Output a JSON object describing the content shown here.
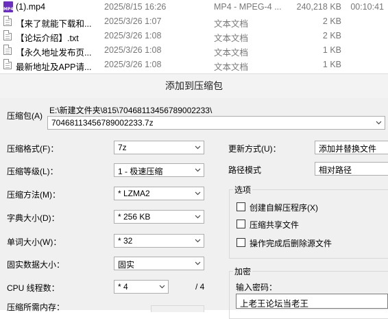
{
  "files": [
    {
      "name": "(1).mp4",
      "date": "2025/8/15 16:26",
      "type": "MP4 - MPEG-4 ...",
      "size": "240,218 KB",
      "duration": "00:10:41",
      "icon": "mp4-file-icon"
    },
    {
      "name": "【来了就能下载和...",
      "date": "2025/3/26 1:07",
      "type": "文本文档",
      "size": "2 KB",
      "duration": "",
      "icon": "text-file-icon"
    },
    {
      "name": "【论坛介绍】.txt",
      "date": "2025/3/26 1:08",
      "type": "文本文档",
      "size": "2 KB",
      "duration": "",
      "icon": "text-file-icon"
    },
    {
      "name": "【永久地址发布页...",
      "date": "2025/3/26 1:08",
      "type": "文本文档",
      "size": "1 KB",
      "duration": "",
      "icon": "text-file-icon"
    },
    {
      "name": "最新地址及APP请...",
      "date": "2025/3/26 1:08",
      "type": "文本文档",
      "size": "1 KB",
      "duration": "",
      "icon": "text-file-icon"
    }
  ],
  "dialog": {
    "title": "添加到压缩包",
    "archive_label": "压缩包(A)",
    "archive_path": "E:\\新建文件夹\\815\\70468113456789002233\\",
    "archive_name": "70468113456789002233.7z",
    "format_label": "压缩格式(F)：",
    "format_value": "7z",
    "level_label": "压缩等级(L)：",
    "level_value": "1 - 极速压缩",
    "method_label": "压缩方法(M)：",
    "method_value": "*  LZMA2",
    "dict_label": "字典大小(D)：",
    "dict_value": "*  256 KB",
    "word_label": "单词大小(W)：",
    "word_value": "*  32",
    "solid_label": "固实数据大小：",
    "solid_value": "固实",
    "threads_label": "CPU 线程数：",
    "threads_value": "*  4",
    "threads_max": "/ 4",
    "memory_label": "压缩所需内存：",
    "update_label": "更新方式(U)：",
    "update_value": "添加并替换文件",
    "path_label": "路径模式",
    "path_value": "相对路径",
    "options_title": "选项",
    "opt_sfx": "创建自解压程序(X)",
    "opt_shared": "压缩共享文件",
    "opt_delete": "操作完成后删除源文件",
    "encrypt_title": "加密",
    "password_label": "输入密码：",
    "password_value": "上老王论坛当老王"
  }
}
